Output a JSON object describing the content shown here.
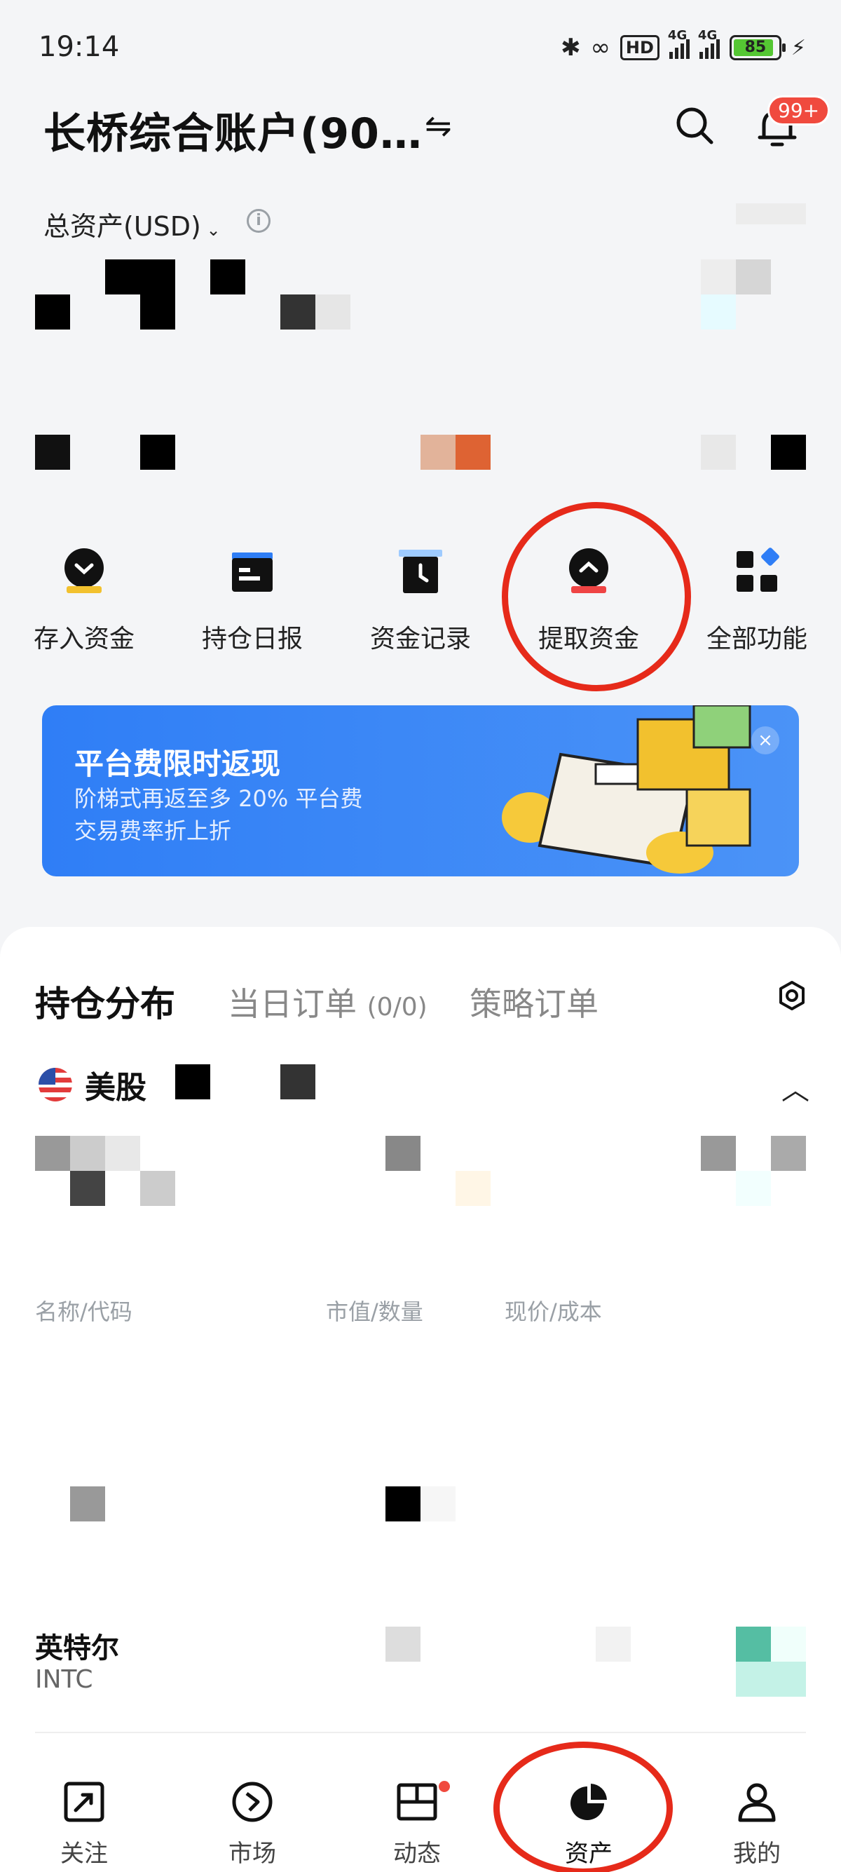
{
  "status_bar": {
    "time": "19:14",
    "hd_label": "HD",
    "signal_1": "4G",
    "signal_2": "4G",
    "battery": "85"
  },
  "header": {
    "account_title": "长桥综合账户(90…",
    "notification_badge": "99+"
  },
  "assets": {
    "total_label": "总资产(USD)"
  },
  "quick_actions": [
    {
      "label": "存入资金",
      "icon": "deposit-icon"
    },
    {
      "label": "持仓日报",
      "icon": "daily-report-icon"
    },
    {
      "label": "资金记录",
      "icon": "fund-record-icon"
    },
    {
      "label": "提取资金",
      "icon": "withdraw-icon"
    },
    {
      "label": "全部功能",
      "icon": "all-features-icon"
    }
  ],
  "banner": {
    "title": "平台费限时返现",
    "line1": "阶梯式再返至多 20% 平台费",
    "line2": "交易费率折上折",
    "close": "×"
  },
  "holdings": {
    "tabs": [
      {
        "label": "持仓分布"
      },
      {
        "label": "当日订单",
        "count": "(0/0)"
      },
      {
        "label": "策略订单"
      }
    ],
    "market": "美股",
    "columns": [
      "名称/代码",
      "市值/数量",
      "现价/成本"
    ],
    "rows": [
      {
        "name": "英特尔",
        "code": "INTC"
      }
    ]
  },
  "tab_bar": [
    {
      "label": "关注",
      "icon": "watchlist-icon"
    },
    {
      "label": "市场",
      "icon": "market-icon"
    },
    {
      "label": "动态",
      "icon": "feed-icon"
    },
    {
      "label": "资产",
      "icon": "assets-icon",
      "active": true
    },
    {
      "label": "我的",
      "icon": "profile-icon"
    }
  ],
  "colors": {
    "accent_blue": "#2f7ef6",
    "annotation_red": "#e62a1a",
    "badge_red": "#f04a3e"
  }
}
